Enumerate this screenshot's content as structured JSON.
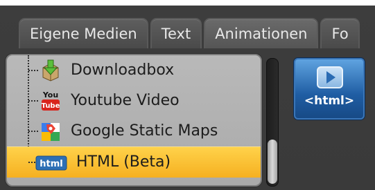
{
  "tabs": [
    {
      "label": "Eigene Medien"
    },
    {
      "label": "Text"
    },
    {
      "label": "Animationen"
    },
    {
      "label": "Fo"
    }
  ],
  "list": {
    "items": [
      {
        "label": "Downloadbox",
        "icon": "download-box-icon"
      },
      {
        "label": "Youtube Video",
        "icon": "youtube-icon",
        "icon_text_top": "You",
        "icon_text_bottom": "Tube"
      },
      {
        "label": "Google Static Maps",
        "icon": "google-maps-icon"
      },
      {
        "label": "HTML (Beta)",
        "icon": "html-badge-icon",
        "icon_text": "html",
        "selected": true
      }
    ]
  },
  "preview_tile": {
    "label": "<html>",
    "icon": "play-icon"
  },
  "colors": {
    "background": "#3d3d3d",
    "selection": "#f5b021",
    "tile_blue": "#1f5da3"
  }
}
